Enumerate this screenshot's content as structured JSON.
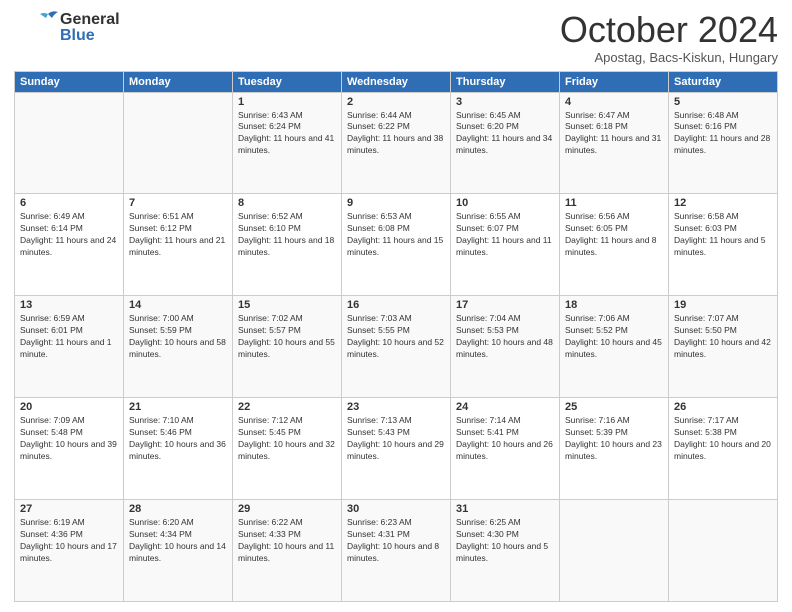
{
  "header": {
    "logo_general": "General",
    "logo_blue": "Blue",
    "month_title": "October 2024",
    "subtitle": "Apostag, Bacs-Kiskun, Hungary"
  },
  "days_of_week": [
    "Sunday",
    "Monday",
    "Tuesday",
    "Wednesday",
    "Thursday",
    "Friday",
    "Saturday"
  ],
  "weeks": [
    [
      {
        "day": "",
        "info": ""
      },
      {
        "day": "",
        "info": ""
      },
      {
        "day": "1",
        "info": "Sunrise: 6:43 AM\nSunset: 6:24 PM\nDaylight: 11 hours and 41 minutes."
      },
      {
        "day": "2",
        "info": "Sunrise: 6:44 AM\nSunset: 6:22 PM\nDaylight: 11 hours and 38 minutes."
      },
      {
        "day": "3",
        "info": "Sunrise: 6:45 AM\nSunset: 6:20 PM\nDaylight: 11 hours and 34 minutes."
      },
      {
        "day": "4",
        "info": "Sunrise: 6:47 AM\nSunset: 6:18 PM\nDaylight: 11 hours and 31 minutes."
      },
      {
        "day": "5",
        "info": "Sunrise: 6:48 AM\nSunset: 6:16 PM\nDaylight: 11 hours and 28 minutes."
      }
    ],
    [
      {
        "day": "6",
        "info": "Sunrise: 6:49 AM\nSunset: 6:14 PM\nDaylight: 11 hours and 24 minutes."
      },
      {
        "day": "7",
        "info": "Sunrise: 6:51 AM\nSunset: 6:12 PM\nDaylight: 11 hours and 21 minutes."
      },
      {
        "day": "8",
        "info": "Sunrise: 6:52 AM\nSunset: 6:10 PM\nDaylight: 11 hours and 18 minutes."
      },
      {
        "day": "9",
        "info": "Sunrise: 6:53 AM\nSunset: 6:08 PM\nDaylight: 11 hours and 15 minutes."
      },
      {
        "day": "10",
        "info": "Sunrise: 6:55 AM\nSunset: 6:07 PM\nDaylight: 11 hours and 11 minutes."
      },
      {
        "day": "11",
        "info": "Sunrise: 6:56 AM\nSunset: 6:05 PM\nDaylight: 11 hours and 8 minutes."
      },
      {
        "day": "12",
        "info": "Sunrise: 6:58 AM\nSunset: 6:03 PM\nDaylight: 11 hours and 5 minutes."
      }
    ],
    [
      {
        "day": "13",
        "info": "Sunrise: 6:59 AM\nSunset: 6:01 PM\nDaylight: 11 hours and 1 minute."
      },
      {
        "day": "14",
        "info": "Sunrise: 7:00 AM\nSunset: 5:59 PM\nDaylight: 10 hours and 58 minutes."
      },
      {
        "day": "15",
        "info": "Sunrise: 7:02 AM\nSunset: 5:57 PM\nDaylight: 10 hours and 55 minutes."
      },
      {
        "day": "16",
        "info": "Sunrise: 7:03 AM\nSunset: 5:55 PM\nDaylight: 10 hours and 52 minutes."
      },
      {
        "day": "17",
        "info": "Sunrise: 7:04 AM\nSunset: 5:53 PM\nDaylight: 10 hours and 48 minutes."
      },
      {
        "day": "18",
        "info": "Sunrise: 7:06 AM\nSunset: 5:52 PM\nDaylight: 10 hours and 45 minutes."
      },
      {
        "day": "19",
        "info": "Sunrise: 7:07 AM\nSunset: 5:50 PM\nDaylight: 10 hours and 42 minutes."
      }
    ],
    [
      {
        "day": "20",
        "info": "Sunrise: 7:09 AM\nSunset: 5:48 PM\nDaylight: 10 hours and 39 minutes."
      },
      {
        "day": "21",
        "info": "Sunrise: 7:10 AM\nSunset: 5:46 PM\nDaylight: 10 hours and 36 minutes."
      },
      {
        "day": "22",
        "info": "Sunrise: 7:12 AM\nSunset: 5:45 PM\nDaylight: 10 hours and 32 minutes."
      },
      {
        "day": "23",
        "info": "Sunrise: 7:13 AM\nSunset: 5:43 PM\nDaylight: 10 hours and 29 minutes."
      },
      {
        "day": "24",
        "info": "Sunrise: 7:14 AM\nSunset: 5:41 PM\nDaylight: 10 hours and 26 minutes."
      },
      {
        "day": "25",
        "info": "Sunrise: 7:16 AM\nSunset: 5:39 PM\nDaylight: 10 hours and 23 minutes."
      },
      {
        "day": "26",
        "info": "Sunrise: 7:17 AM\nSunset: 5:38 PM\nDaylight: 10 hours and 20 minutes."
      }
    ],
    [
      {
        "day": "27",
        "info": "Sunrise: 6:19 AM\nSunset: 4:36 PM\nDaylight: 10 hours and 17 minutes."
      },
      {
        "day": "28",
        "info": "Sunrise: 6:20 AM\nSunset: 4:34 PM\nDaylight: 10 hours and 14 minutes."
      },
      {
        "day": "29",
        "info": "Sunrise: 6:22 AM\nSunset: 4:33 PM\nDaylight: 10 hours and 11 minutes."
      },
      {
        "day": "30",
        "info": "Sunrise: 6:23 AM\nSunset: 4:31 PM\nDaylight: 10 hours and 8 minutes."
      },
      {
        "day": "31",
        "info": "Sunrise: 6:25 AM\nSunset: 4:30 PM\nDaylight: 10 hours and 5 minutes."
      },
      {
        "day": "",
        "info": ""
      },
      {
        "day": "",
        "info": ""
      }
    ]
  ]
}
